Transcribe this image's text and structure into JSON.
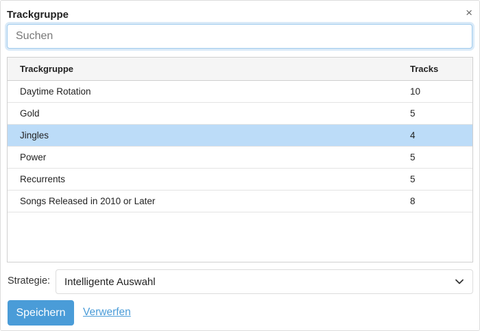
{
  "dialog": {
    "title": "Trackgruppe",
    "close_glyph": "×"
  },
  "search": {
    "placeholder": "Suchen",
    "value": ""
  },
  "table": {
    "headers": [
      "Trackgruppe",
      "Tracks"
    ],
    "rows": [
      {
        "name": "Daytime Rotation",
        "tracks": "10",
        "selected": false
      },
      {
        "name": "Gold",
        "tracks": "5",
        "selected": false
      },
      {
        "name": "Jingles",
        "tracks": "4",
        "selected": true
      },
      {
        "name": "Power",
        "tracks": "5",
        "selected": false
      },
      {
        "name": "Recurrents",
        "tracks": "5",
        "selected": false
      },
      {
        "name": "Songs Released in 2010 or Later",
        "tracks": "8",
        "selected": false
      }
    ]
  },
  "strategy": {
    "label": "Strategie:",
    "selected": "Intelligente Auswahl",
    "icon": "chevron-down-icon"
  },
  "actions": {
    "save_label": "Speichern",
    "discard_label": "Verwerfen"
  },
  "colors": {
    "accent": "#4a9cd8",
    "selected_row": "#bcdcf8",
    "focus_border": "#9ecaed"
  }
}
